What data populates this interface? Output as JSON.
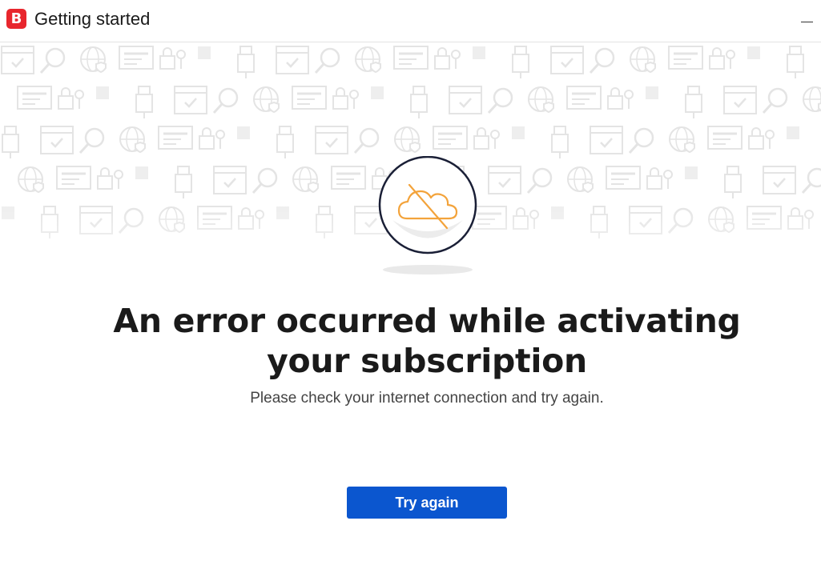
{
  "window": {
    "title": "Getting started",
    "logo_letter": "B",
    "minimize_icon": "minimize-icon"
  },
  "main": {
    "illustration_icon": "cloud-offline-icon",
    "heading": "An error occurred while activating your subscription",
    "message": "Please check your internet connection and try again.",
    "retry_button_label": "Try again"
  },
  "colors": {
    "brand": "#e8262d",
    "accent_button": "#0b56cf",
    "illustration_orange": "#f3a33b",
    "illustration_ring": "#1a1f36"
  }
}
